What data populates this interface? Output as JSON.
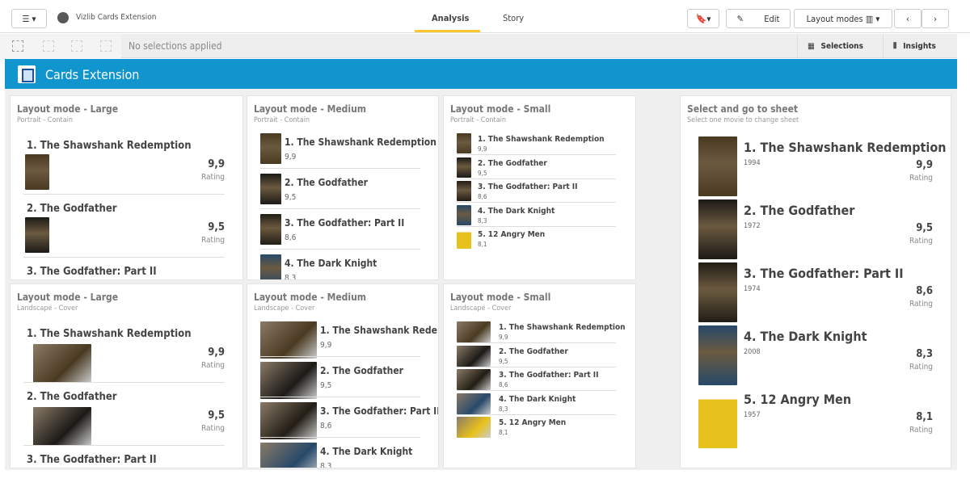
{
  "topbar": {
    "app_title": "Vizlib Cards Extension",
    "tabs": [
      "Analysis",
      "Story"
    ],
    "edit_label": "Edit",
    "layout_modes_label": "Layout modes"
  },
  "selections": {
    "none_text": "No selections applied",
    "selections_label": "Selections",
    "insights_label": "Insights"
  },
  "sheet": {
    "title": "Cards Extension"
  },
  "movies": [
    {
      "title": "1. The Shawshank Redemption",
      "short_title": "1. The Shawshank Rede.",
      "rating": "9,9",
      "year": "1994",
      "color": "#4a3a22"
    },
    {
      "title": "2. The Godfather",
      "rating": "9,5",
      "year": "1972",
      "color": "#1c1a17"
    },
    {
      "title": "3. The Godfather: Part II",
      "rating": "8,6",
      "year": "1974",
      "color": "#221d15"
    },
    {
      "title": "4. The Dark Knight",
      "rating": "8,3",
      "year": "2008",
      "color": "#27496a"
    },
    {
      "title": "5. 12 Angry Men",
      "rating": "8,1",
      "year": "1957",
      "color": "#e8c21c"
    }
  ],
  "rating_label": "Rating",
  "panels": [
    {
      "title": "Layout mode - Large",
      "subtitle": "Portrait - Contain",
      "mode": "large",
      "orient": "portrait"
    },
    {
      "title": "Layout mode - Medium",
      "subtitle": "Portrait - Contain",
      "mode": "medium",
      "orient": "portrait"
    },
    {
      "title": "Layout mode - Small",
      "subtitle": "Portrait - Contain",
      "mode": "small",
      "orient": "portrait"
    },
    {
      "title": "Layout mode - Large",
      "subtitle": "Landscape - Cover",
      "mode": "large",
      "orient": "landscape"
    },
    {
      "title": "Layout mode - Medium",
      "subtitle": "Landscape - Cover",
      "mode": "medium",
      "orient": "landscape"
    },
    {
      "title": "Layout mode - Small",
      "subtitle": "Landscape - Cover",
      "mode": "small",
      "orient": "landscape"
    },
    {
      "title": "Select and go to sheet",
      "subtitle": "Select one movie to change sheet",
      "mode": "select",
      "orient": "portrait"
    }
  ]
}
